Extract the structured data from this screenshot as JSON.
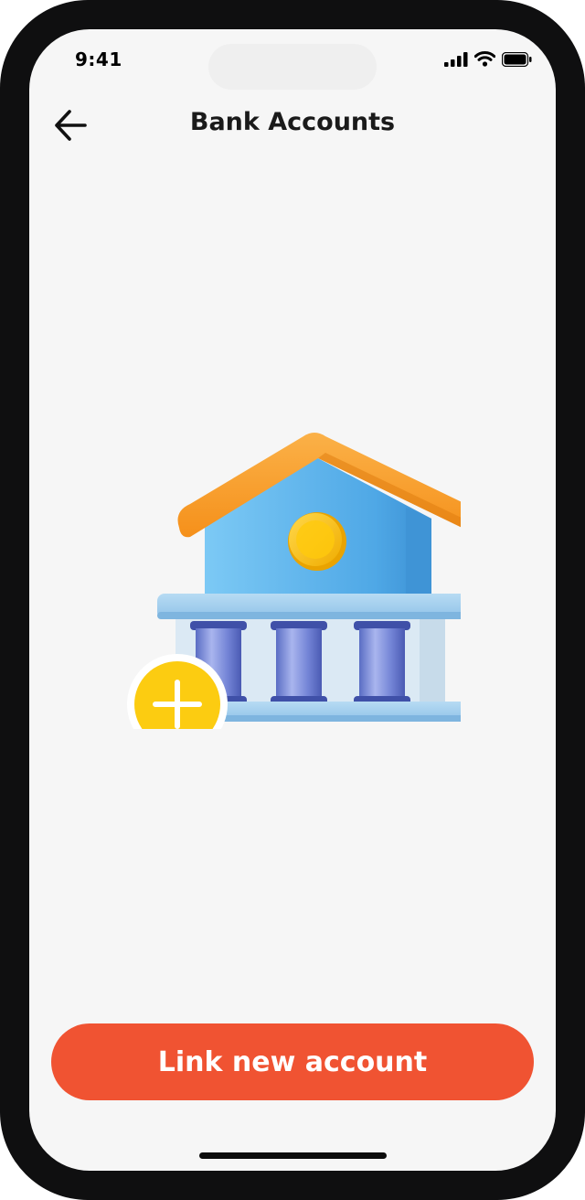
{
  "status_bar": {
    "time": "9:41",
    "icons": [
      "cellular-signal-icon",
      "wifi-icon",
      "battery-icon"
    ]
  },
  "nav": {
    "back_icon": "arrow-left-icon",
    "title": "Bank Accounts"
  },
  "illustration": {
    "subject": "bank-building-illustration",
    "badge_icon": "plus-circle-icon"
  },
  "cta": {
    "label": "Link new account",
    "color": "#f05332"
  },
  "colors": {
    "screen_background": "#f6f6f6",
    "roof": "#f6a020",
    "building": "#5fb7ec",
    "coin": "#f8c400",
    "badge": "#fccc11"
  }
}
